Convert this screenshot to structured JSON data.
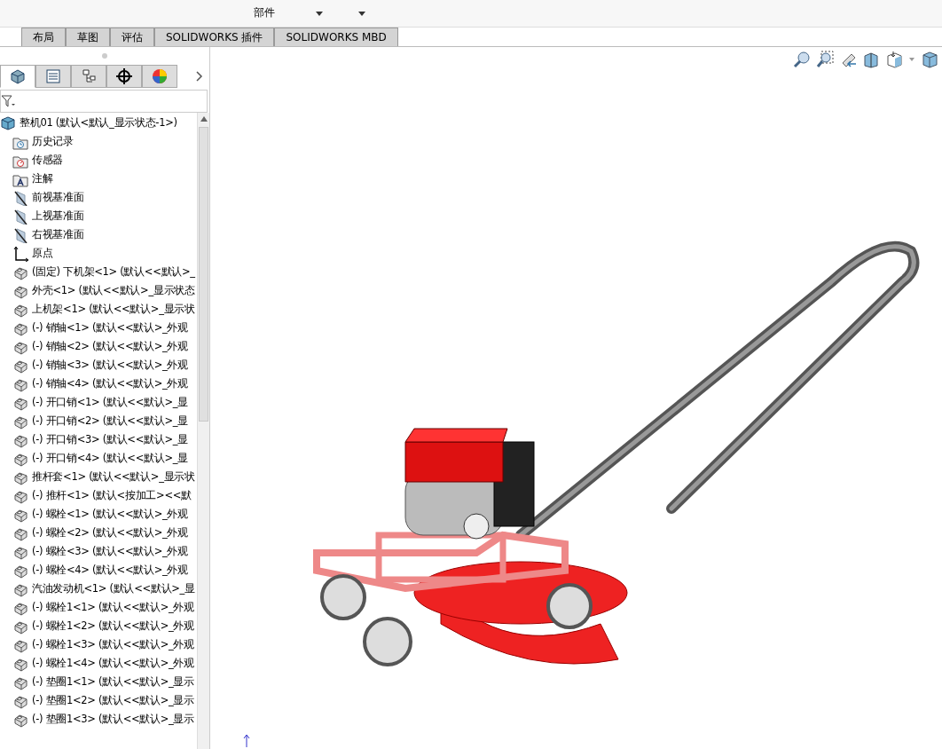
{
  "toolbar": {
    "items": [
      {
        "kind": "button",
        "label": "部件"
      },
      {
        "kind": "dropdown"
      },
      {
        "kind": "dropdown"
      }
    ]
  },
  "tabs": [
    {
      "label": "布局",
      "selected": false
    },
    {
      "label": "草图",
      "selected": false
    },
    {
      "label": "评估",
      "selected": false
    },
    {
      "label": "SOLIDWORKS 插件",
      "selected": false
    },
    {
      "label": "SOLIDWORKS MBD",
      "selected": false
    }
  ],
  "panel_tabs": [
    {
      "kind": "feature",
      "selected": true
    },
    {
      "kind": "property",
      "selected": false
    },
    {
      "kind": "config",
      "selected": false
    },
    {
      "kind": "dimxpert",
      "selected": false
    },
    {
      "kind": "display",
      "selected": false
    }
  ],
  "tree": {
    "root": "整机01  (默认<默认_显示状态-1>)",
    "items": [
      {
        "kind": "history",
        "label": "历史记录"
      },
      {
        "kind": "sensor",
        "label": "传感器"
      },
      {
        "kind": "annotation",
        "label": "注解"
      },
      {
        "kind": "plane",
        "label": "前视基准面"
      },
      {
        "kind": "plane",
        "label": "上视基准面"
      },
      {
        "kind": "plane",
        "label": "右视基准面"
      },
      {
        "kind": "origin",
        "label": "原点"
      },
      {
        "kind": "part",
        "label": "(固定) 下机架<1> (默认<<默认>_"
      },
      {
        "kind": "part",
        "label": "外壳<1> (默认<<默认>_显示状态"
      },
      {
        "kind": "part",
        "label": "上机架<1> (默认<<默认>_显示状"
      },
      {
        "kind": "part",
        "label": "(-) 销轴<1> (默认<<默认>_外观"
      },
      {
        "kind": "part",
        "label": "(-) 销轴<2> (默认<<默认>_外观"
      },
      {
        "kind": "part",
        "label": "(-) 销轴<3> (默认<<默认>_外观"
      },
      {
        "kind": "part",
        "label": "(-) 销轴<4> (默认<<默认>_外观"
      },
      {
        "kind": "part",
        "label": "(-) 开口销<1> (默认<<默认>_显"
      },
      {
        "kind": "part",
        "label": "(-) 开口销<2> (默认<<默认>_显"
      },
      {
        "kind": "part",
        "label": "(-) 开口销<3> (默认<<默认>_显"
      },
      {
        "kind": "part",
        "label": "(-) 开口销<4> (默认<<默认>_显"
      },
      {
        "kind": "part",
        "label": "推杆套<1> (默认<<默认>_显示状"
      },
      {
        "kind": "part",
        "label": "(-) 推杆<1> (默认<按加工><<默"
      },
      {
        "kind": "part",
        "label": "(-) 螺栓<1> (默认<<默认>_外观"
      },
      {
        "kind": "part",
        "label": "(-) 螺栓<2> (默认<<默认>_外观"
      },
      {
        "kind": "part",
        "label": "(-) 螺栓<3> (默认<<默认>_外观"
      },
      {
        "kind": "part",
        "label": "(-) 螺栓<4> (默认<<默认>_外观"
      },
      {
        "kind": "part",
        "label": "汽油发动机<1> (默认<<默认>_显"
      },
      {
        "kind": "part",
        "label": "(-) 螺栓1<1> (默认<<默认>_外观"
      },
      {
        "kind": "part",
        "label": "(-) 螺栓1<2> (默认<<默认>_外观"
      },
      {
        "kind": "part",
        "label": "(-) 螺栓1<3> (默认<<默认>_外观"
      },
      {
        "kind": "part",
        "label": "(-) 螺栓1<4> (默认<<默认>_外观"
      },
      {
        "kind": "part",
        "label": "(-) 垫圈1<1> (默认<<默认>_显示"
      },
      {
        "kind": "part",
        "label": "(-) 垫圈1<2> (默认<<默认>_显示"
      },
      {
        "kind": "part",
        "label": "(-) 垫圈1<3> (默认<<默认>_显示"
      }
    ]
  },
  "view_tools": [
    {
      "kind": "zoom-fit"
    },
    {
      "kind": "zoom-area"
    },
    {
      "kind": "previous"
    },
    {
      "kind": "section"
    },
    {
      "kind": "orientation"
    },
    {
      "kind": "caret"
    },
    {
      "kind": "display"
    }
  ]
}
